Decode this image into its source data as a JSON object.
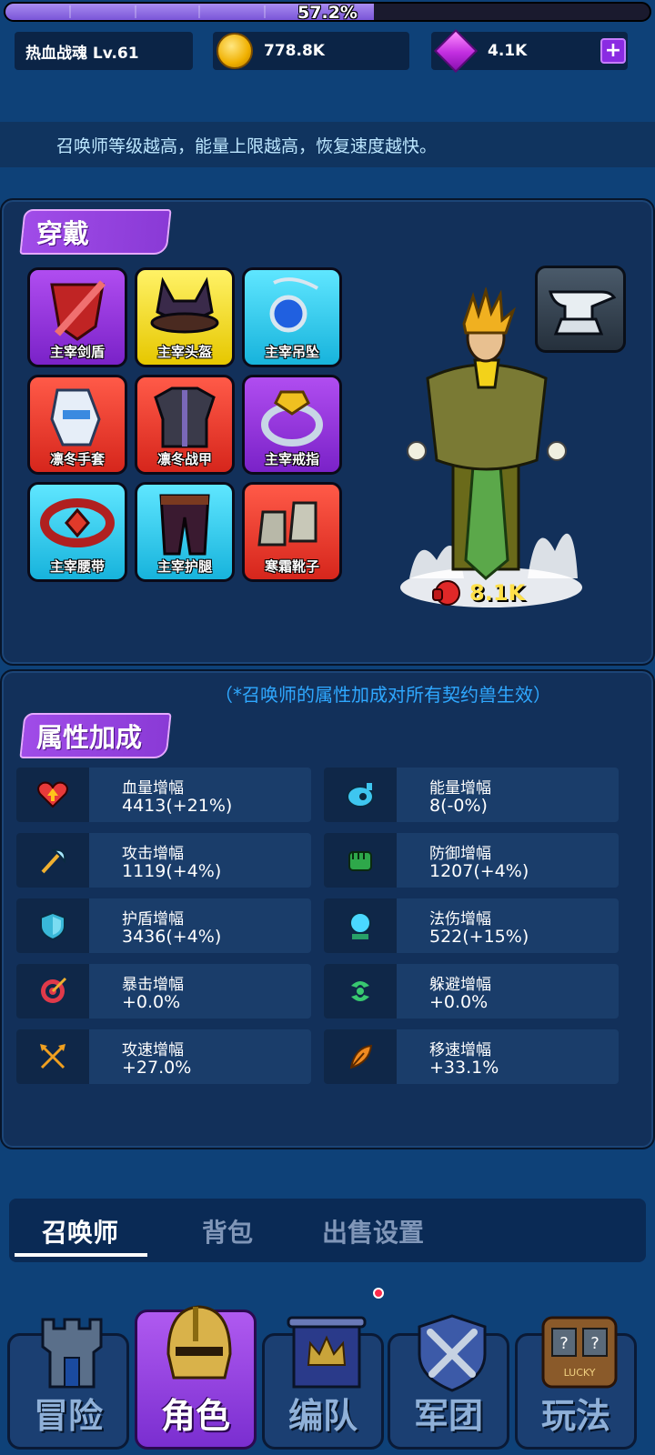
{
  "xp": {
    "percent_text": "57.2%",
    "fraction": 0.572
  },
  "header": {
    "player_label": "热血战魂 Lv.61",
    "coins": "778.8K",
    "gems": "4.1K",
    "plus_symbol": "+"
  },
  "tip": "召唤师等级越高，能量上限越高，恢复速度越快。",
  "equip_section": {
    "title": "穿戴",
    "items": [
      {
        "label": "主宰剑盾",
        "color": "purple",
        "icon": "sword-shield-icon"
      },
      {
        "label": "主宰头盔",
        "color": "yellow",
        "icon": "helmet-icon"
      },
      {
        "label": "主宰吊坠",
        "color": "cyan",
        "icon": "pendant-icon"
      },
      {
        "label": "凛冬手套",
        "color": "red",
        "icon": "gloves-icon"
      },
      {
        "label": "凛冬战甲",
        "color": "red",
        "icon": "armor-icon"
      },
      {
        "label": "主宰戒指",
        "color": "purple",
        "icon": "ring-icon"
      },
      {
        "label": "主宰腰带",
        "color": "cyan",
        "icon": "belt-icon"
      },
      {
        "label": "主宰护腿",
        "color": "cyan",
        "icon": "leggings-icon"
      },
      {
        "label": "寒霜靴子",
        "color": "red",
        "icon": "boots-icon"
      }
    ],
    "power": "8.1K",
    "forge_icon": "anvil-icon"
  },
  "stats_section": {
    "note": "（*召唤师的属性加成对所有契约兽生效）",
    "title": "属性加成",
    "stats": [
      {
        "name": "血量增幅",
        "value": "4413(+21%)",
        "icon": "heart-icon"
      },
      {
        "name": "能量增幅",
        "value": "8(-0%)",
        "icon": "energy-flask-icon"
      },
      {
        "name": "攻击增幅",
        "value": "1119(+4%)",
        "icon": "axe-icon"
      },
      {
        "name": "防御增幅",
        "value": "1207(+4%)",
        "icon": "fist-icon"
      },
      {
        "name": "护盾增幅",
        "value": "3436(+4%)",
        "icon": "shield-icon"
      },
      {
        "name": "法伤增幅",
        "value": "522(+15%)",
        "icon": "crystal-ball-icon"
      },
      {
        "name": "暴击增幅",
        "value": "+0.0%",
        "icon": "target-icon"
      },
      {
        "name": "躲避增幅",
        "value": "+0.0%",
        "icon": "dodge-icon"
      },
      {
        "name": "攻速增幅",
        "value": "+27.0%",
        "icon": "crossed-arrows-icon"
      },
      {
        "name": "移速增幅",
        "value": "+33.1%",
        "icon": "feather-icon"
      }
    ]
  },
  "tabs": [
    {
      "label": "召唤师",
      "active": true
    },
    {
      "label": "背包",
      "active": false
    },
    {
      "label": "出售设置",
      "active": false
    }
  ],
  "nav": [
    {
      "label": "冒险",
      "icon": "tower-icon",
      "active": false
    },
    {
      "label": "角色",
      "icon": "knight-helmet-icon",
      "active": true
    },
    {
      "label": "编队",
      "icon": "banner-crown-icon",
      "active": false
    },
    {
      "label": "军团",
      "icon": "crossed-swords-icon",
      "active": false
    },
    {
      "label": "玩法",
      "icon": "slot-machine-icon",
      "active": false
    }
  ],
  "nav_slot_text": "LUCKY",
  "colors": {
    "background": "#0e4178",
    "panel": "#12305a",
    "accent_purple": "#9b45e4",
    "note_blue": "#2fa8ff"
  }
}
